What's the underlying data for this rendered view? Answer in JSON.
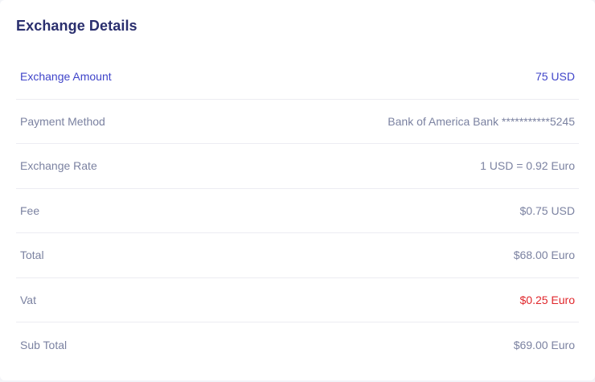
{
  "card": {
    "title": "Exchange Details"
  },
  "details": [
    {
      "label": "Exchange Amount",
      "value": "75 USD"
    },
    {
      "label": "Payment Method",
      "value": "Bank of America Bank ***********5245"
    },
    {
      "label": "Exchange Rate",
      "value": "1 USD = 0.92 Euro"
    },
    {
      "label": "Fee",
      "value": "$0.75 USD"
    },
    {
      "label": "Total",
      "value": "$68.00 Euro"
    },
    {
      "label": "Vat",
      "value": "$0.25 Euro"
    },
    {
      "label": "Sub Total",
      "value": "$69.00 Euro"
    }
  ],
  "colors": {
    "title": "#2a2f6e",
    "accent": "#3f44c9",
    "muted": "#7b82a1",
    "danger": "#e0262b"
  }
}
